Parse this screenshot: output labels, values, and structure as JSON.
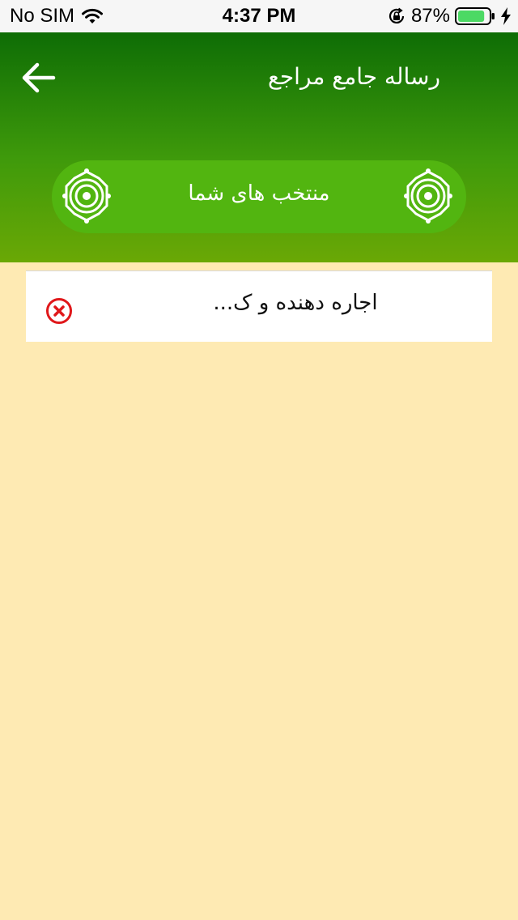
{
  "status_bar": {
    "carrier": "No SIM",
    "time": "4:37 PM",
    "battery_percent": "87%",
    "battery_level": 0.87,
    "icons": [
      "wifi-icon",
      "rotation-lock-icon",
      "battery-icon",
      "charging-bolt-icon"
    ]
  },
  "header": {
    "title": "رساله جامع مراجع",
    "back_icon": "arrow-left-icon",
    "favorites_label": "منتخب های شما",
    "ornament_icon": "ornament-medallion-icon"
  },
  "favorites": {
    "items": [
      {
        "title": "اجاره دهنده و ک...",
        "remove_icon": "remove-circle-icon"
      }
    ]
  },
  "colors": {
    "header_top": "#0e6d05",
    "header_bottom": "#6aa805",
    "pill": "#52b510",
    "page_background": "#feeab3",
    "remove_red": "#e0181b",
    "battery_green": "#4cd964"
  }
}
